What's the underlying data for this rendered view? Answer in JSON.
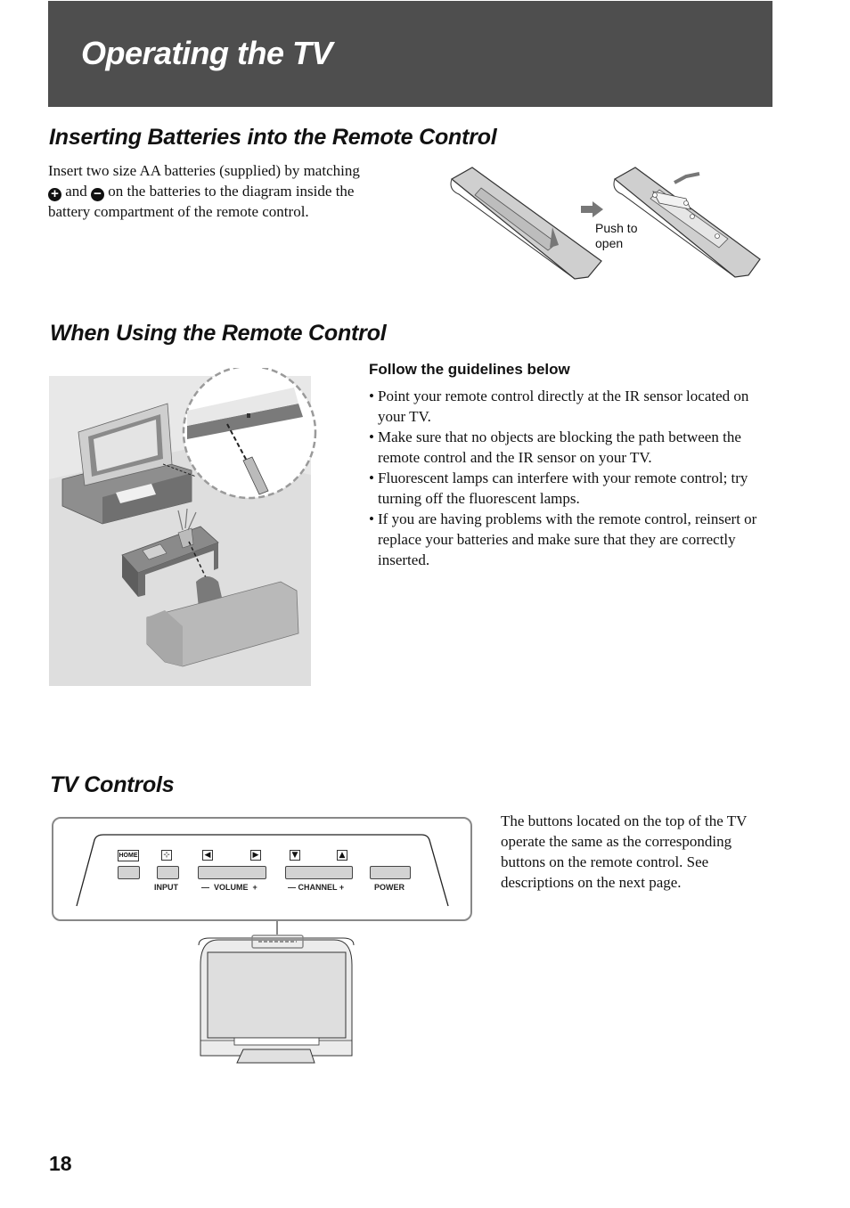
{
  "page": {
    "title": "Operating the TV",
    "page_number": "18"
  },
  "batteries": {
    "heading": "Inserting Batteries into the Remote Control",
    "text_part1": "Insert two size AA batteries (supplied) by matching",
    "plus_symbol": "+",
    "text_and": " and ",
    "minus_symbol": "−",
    "text_part2": " on the batteries to the diagram inside the",
    "text_part3": "battery compartment of the remote control.",
    "illustration_label_line1": "Push to",
    "illustration_label_line2": "open"
  },
  "remote_use": {
    "heading": "When Using the Remote Control",
    "guidelines_title": "Follow the guidelines below",
    "guidelines": [
      "Point your remote control directly at the IR sensor located on your TV.",
      "Make sure that no objects are blocking the path between the remote control and the IR sensor on your TV.",
      "Fluorescent lamps can interfere with your remote control; try turning off the fluorescent lamps.",
      "If you are having problems with the remote control, reinsert or replace your batteries and make sure that they are correctly inserted."
    ]
  },
  "tv_controls": {
    "heading": "TV Controls",
    "description": "The buttons located on the top of the TV operate the same as the corresponding buttons on the remote control. See descriptions on the next page.",
    "home_icon_label": "HOME",
    "input_icon_glyph": "⊹",
    "vol_down_glyph": "◀",
    "vol_up_glyph": "▶",
    "ch_down_glyph": "▼",
    "ch_up_glyph": "▲",
    "labels": {
      "input": "INPUT",
      "volume": "—  VOLUME  +",
      "channel": "— CHANNEL +",
      "power": "POWER"
    }
  }
}
